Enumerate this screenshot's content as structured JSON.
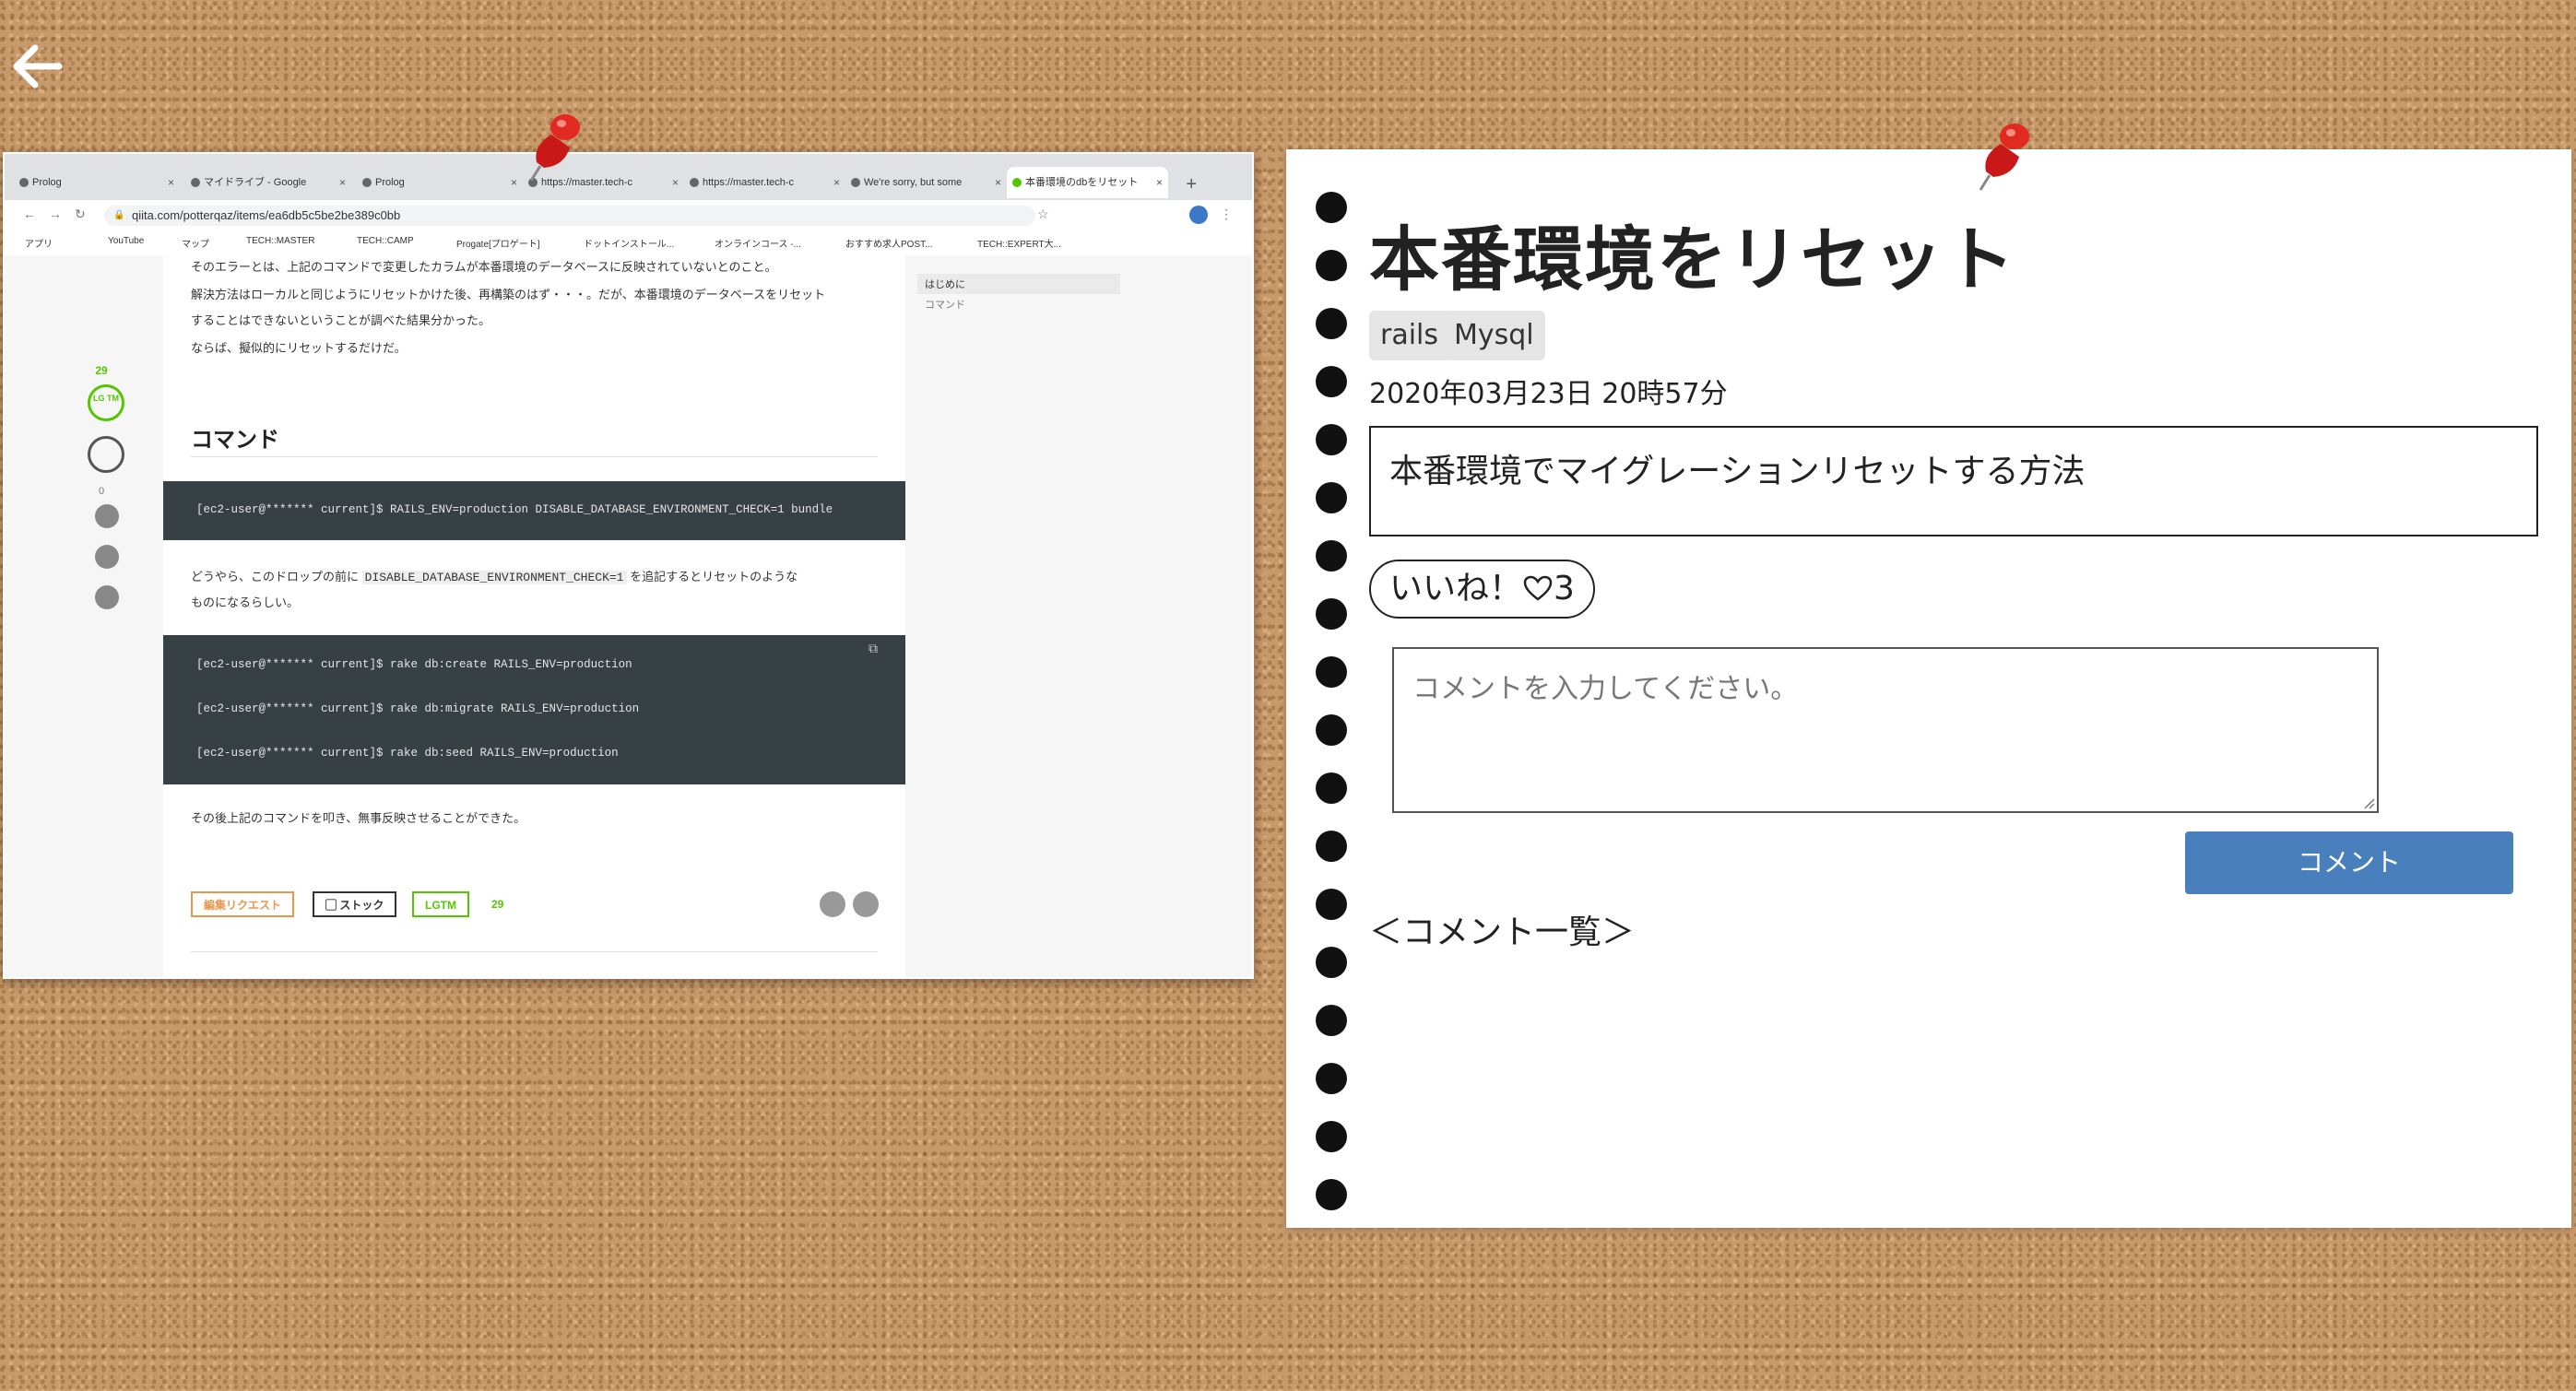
{
  "browser": {
    "tabs": [
      {
        "label": "Prolog",
        "active": false
      },
      {
        "label": "マイドライブ - Google",
        "active": false
      },
      {
        "label": "Prolog",
        "active": false
      },
      {
        "label": "https://master.tech-c",
        "active": false
      },
      {
        "label": "https://master.tech-c",
        "active": false
      },
      {
        "label": "We're sorry, but some",
        "active": false
      },
      {
        "label": "本番環境のdbをリセット",
        "active": true
      }
    ],
    "url": "qiita.com/potterqaz/items/ea6db5c5be2be389c0bb",
    "bookmarks": [
      "アプリ",
      "YouTube",
      "マップ",
      "TECH::MASTER",
      "TECH::CAMP",
      "Progate[プロゲート]",
      "ドットインストール...",
      "オンラインコース -...",
      "おすすめ求人POST...",
      "TECH::EXPERT大..."
    ]
  },
  "qiita": {
    "paragraphs": [
      "そのエラーとは、上記のコマンドで変更したカラムが本番環境のデータベースに反映されていないとのこと。",
      "解決方法はローカルと同じようにリセットかけた後、再構築のはず・・・。だが、本番環境のデータベースをリセット",
      "することはできないということが調べた結果分かった。",
      "ならば、擬似的にリセットするだけだ。"
    ],
    "heading": "コマンド",
    "code1": "[ec2-user@******* current]$ RAILS_ENV=production DISABLE_DATABASE_ENVIRONMENT_CHECK=1 bundle",
    "note_before": "どうやら、このドロップの前に",
    "note_code": "DISABLE_DATABASE_ENVIRONMENT_CHECK=1",
    "note_after": "を追記するとリセットのような",
    "note_line2": "ものになるらしい。",
    "code2": [
      "[ec2-user@******* current]$ rake db:create RAILS_ENV=production",
      "[ec2-user@******* current]$ rake db:migrate RAILS_ENV=production",
      "[ec2-user@******* current]$ rake db:seed RAILS_ENV=production"
    ],
    "after_text": "その後上記のコマンドを叩き、無事反映させることができた。",
    "edit_request": "編集リクエスト",
    "stock": "ストック",
    "lgtm": "LGTM",
    "lgtm_count": "29",
    "side_lgtm_count": "29",
    "side_lgtm_icon": "LG TM",
    "side_comment_count": "0",
    "toc": [
      "はじめに",
      "コマンド"
    ]
  },
  "post": {
    "title": "本番環境をリセット",
    "tags": [
      "rails",
      "Mysql"
    ],
    "date": "2020年03月23日 20時57分",
    "description": "本番環境でマイグレーションリセットする方法",
    "like_label": "いいね！",
    "like_count": "3",
    "comment_placeholder": "コメントを入力してください。",
    "comment_button": "コメント",
    "comment_list_heading": "＜コメント一覧＞"
  },
  "colors": {
    "cork": "#c8996a",
    "code_bg": "#364045",
    "button_blue": "#4a7fbe",
    "qiita_green": "#55c500",
    "edit_orange": "#e8964a",
    "pin_red": "#d8201c"
  },
  "icons": [
    "back-arrow-icon",
    "heart-icon",
    "push-pin-icon",
    "stock-icon",
    "twitter-icon",
    "facebook-icon",
    "comment-icon",
    "copy-icon",
    "lock-icon"
  ]
}
